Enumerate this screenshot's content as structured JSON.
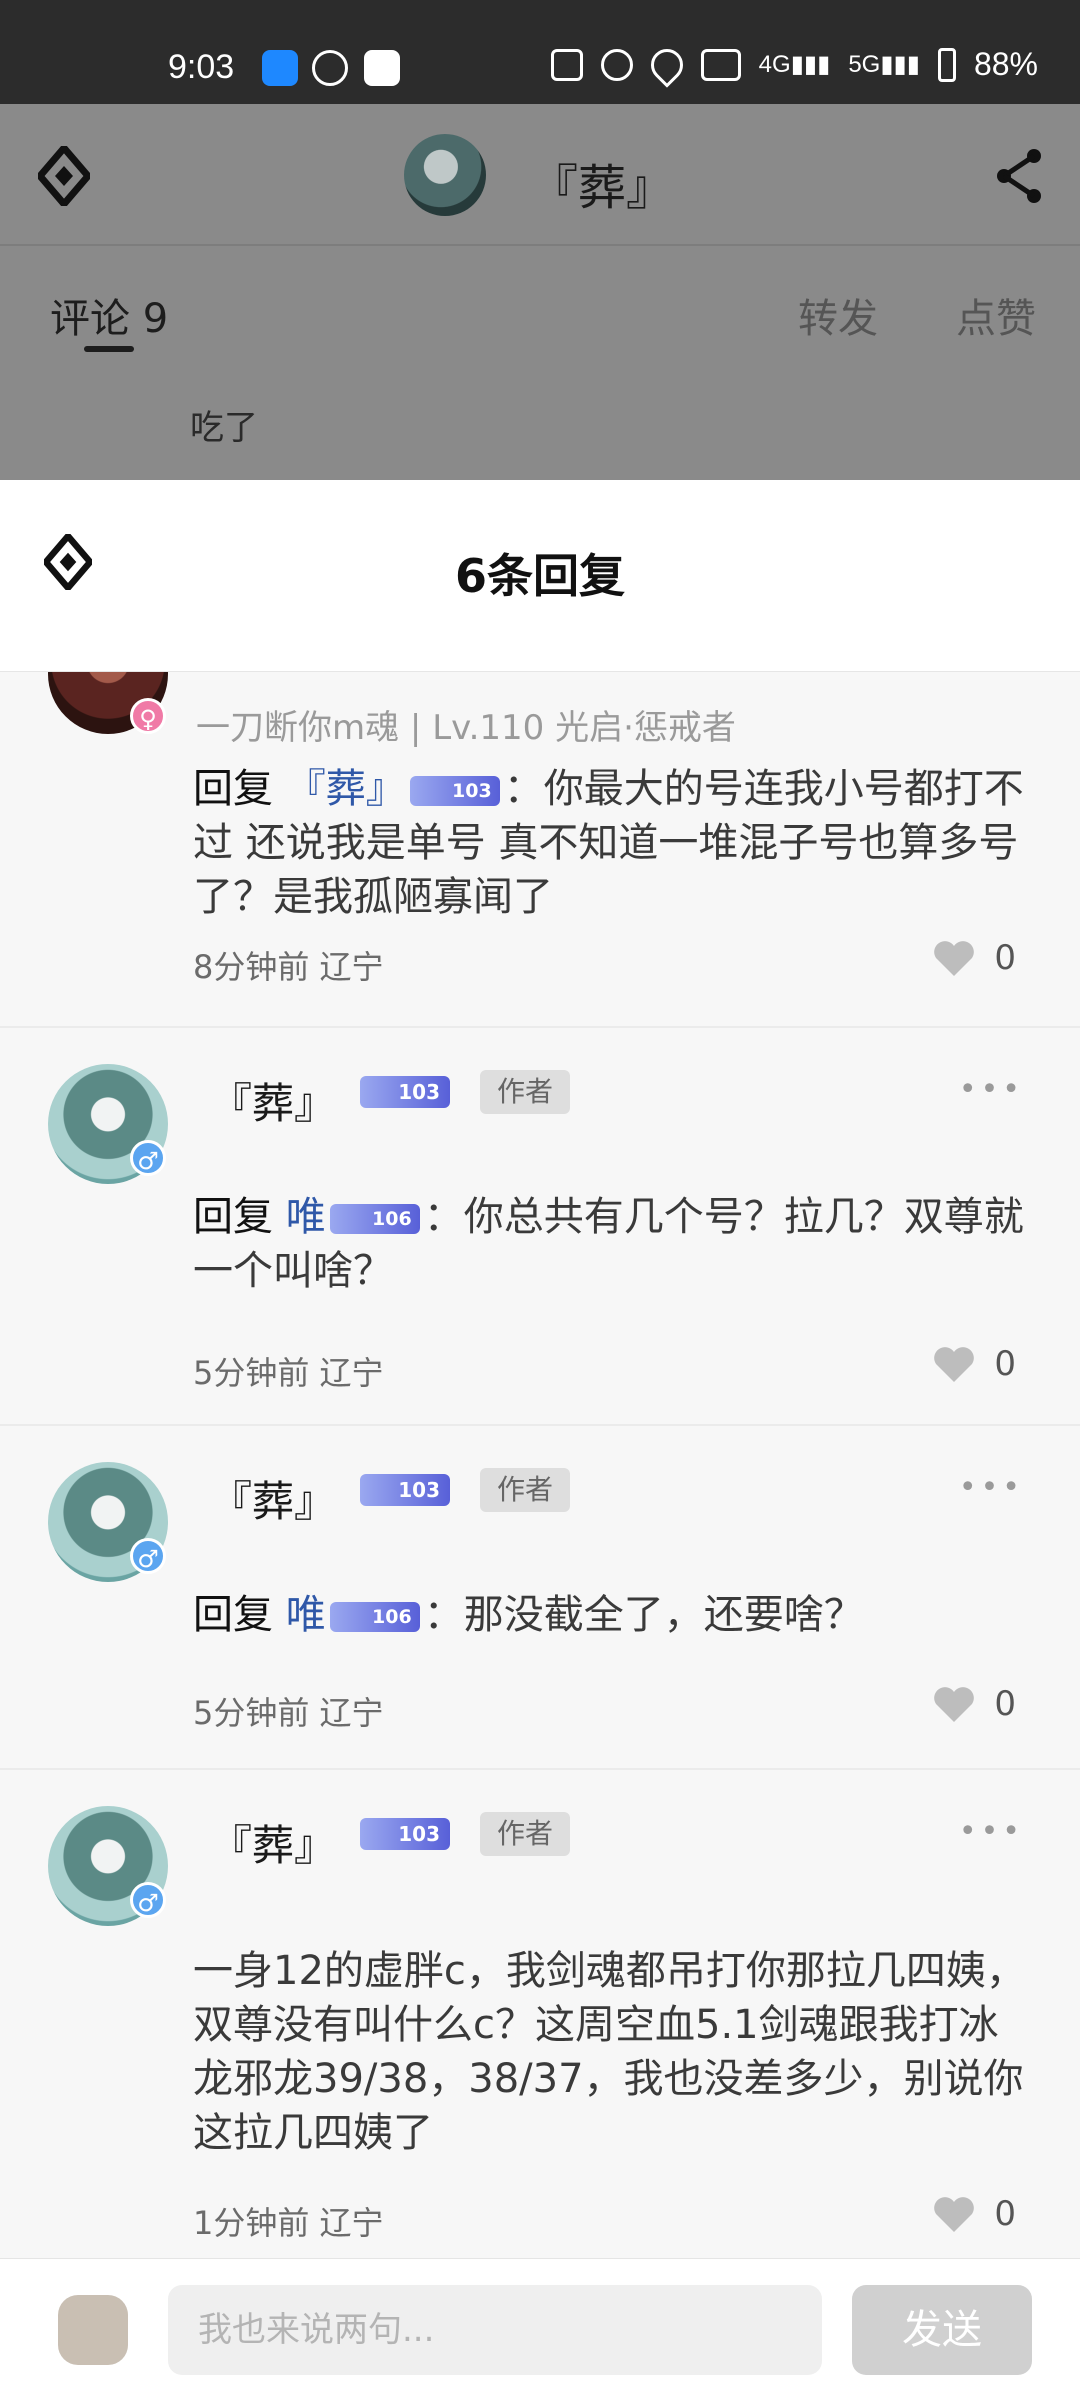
{
  "status_bar": {
    "time": "9:03",
    "battery": "88%"
  },
  "top": {
    "title": "『葬』",
    "tab_comments": "评论 9",
    "tab_forward": "转发",
    "tab_like": "点赞",
    "snippet": "吃了"
  },
  "sheet": {
    "heading": "6条回复"
  },
  "comments": [
    {
      "meta": "一刀断你m魂 | Lv.110 光启·惩戒者",
      "reply_prefix": "回复",
      "mention": "『葬』",
      "mention_badge": "103",
      "text": "：你最大的号连我小号都打不过 还说我是单号  真不知道一堆混子号也算多号了？是我孤陋寡闻了",
      "time": "8分钟前 辽宁",
      "likes": "0"
    },
    {
      "name": "『葬』",
      "badge": "103",
      "author_tag": "作者",
      "reply_prefix": "回复",
      "mention": "唯",
      "mention_badge": "106",
      "text": "：你总共有几个号？拉几？双尊就一个叫啥？",
      "time": "5分钟前 辽宁",
      "likes": "0"
    },
    {
      "name": "『葬』",
      "badge": "103",
      "author_tag": "作者",
      "reply_prefix": "回复",
      "mention": "唯",
      "mention_badge": "106",
      "text": "：那没截全了，还要啥？",
      "time": "5分钟前 辽宁",
      "likes": "0"
    },
    {
      "name": "『葬』",
      "badge": "103",
      "author_tag": "作者",
      "text": "一身12的虚胖c，我剑魂都吊打你那拉几四姨，双尊没有叫什么c？这周空血5.1剑魂跟我打冰龙邪龙39/38，38/37，我也没差多少，别说你这拉几四姨了",
      "time": "1分钟前 辽宁",
      "likes": "0"
    }
  ],
  "input": {
    "placeholder": "我也来说两句...",
    "send_label": "发送"
  }
}
